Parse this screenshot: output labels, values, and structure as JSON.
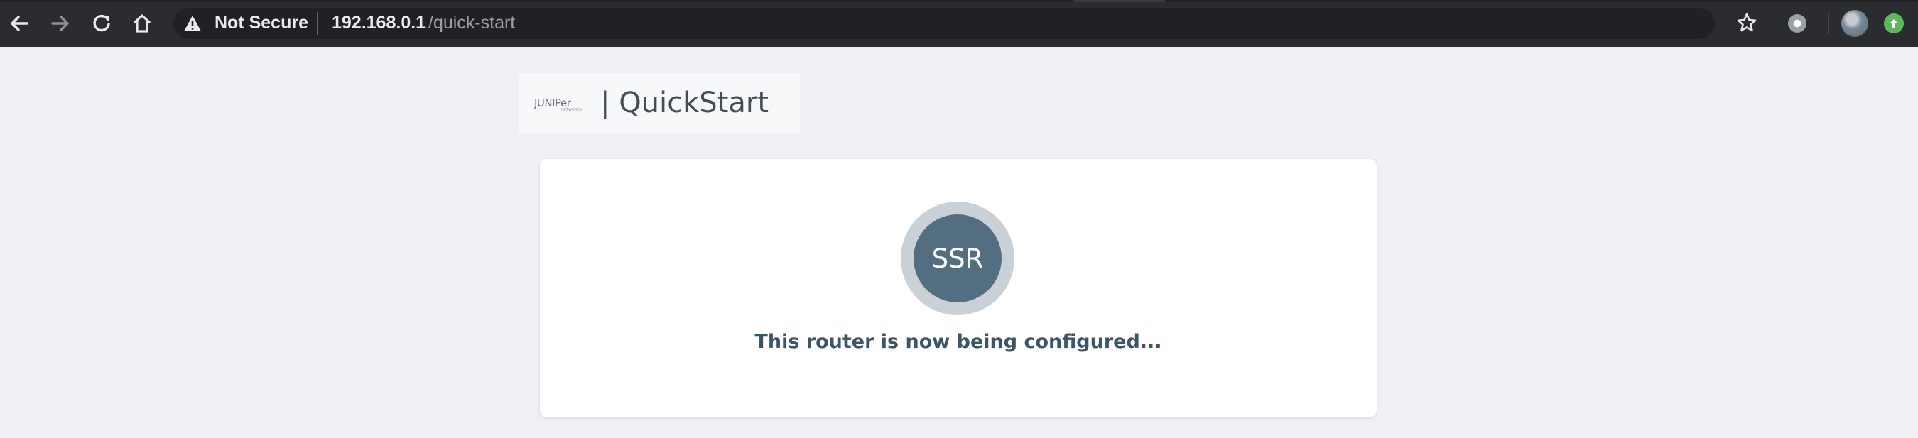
{
  "browser": {
    "security_label": "Not Secure",
    "url_host": "192.168.0.1",
    "url_path": "/quick-start",
    "icons": {
      "back": "back-arrow-icon",
      "forward": "forward-arrow-icon",
      "reload": "reload-icon",
      "home": "home-icon",
      "warning": "warning-triangle-icon",
      "bookmark": "star-icon",
      "extension": "extension-icon",
      "profile": "profile-avatar",
      "update": "update-arrow-icon"
    },
    "colors": {
      "toolbar": "#2b2c2f",
      "omnibox": "#202124",
      "update": "#5cb85c"
    }
  },
  "header": {
    "logo_text": "JUNIPER",
    "title": "| QuickStart"
  },
  "card": {
    "badge_label": "SSR",
    "status": "This router is now being configured..."
  },
  "colors": {
    "page_bg": "#eff0f4",
    "badge_outer": "#c9d1d7",
    "badge_inner": "#536e80",
    "status_text": "#3a5566"
  }
}
